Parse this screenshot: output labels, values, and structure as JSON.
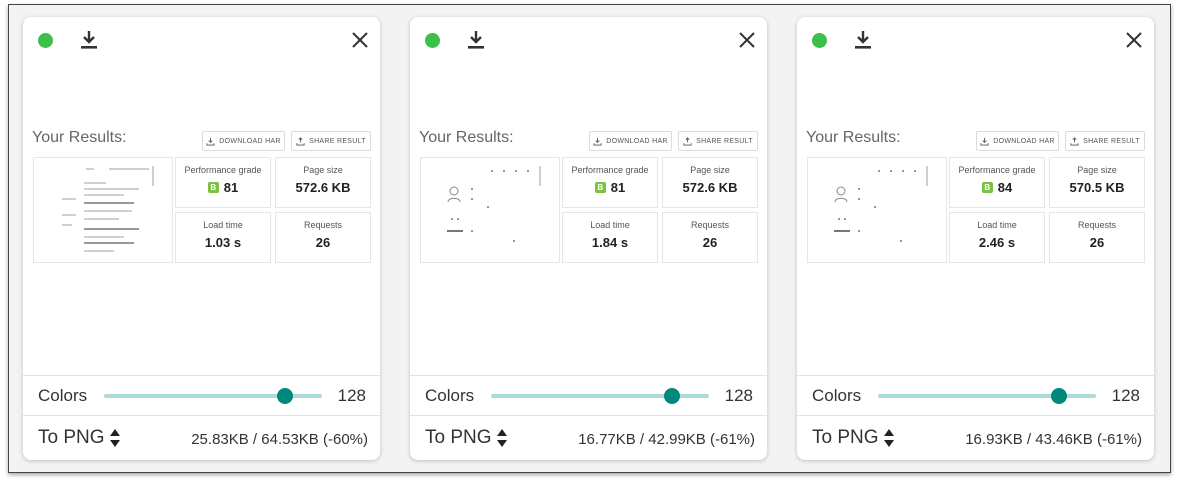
{
  "results_title": "Your Results:",
  "download_har_label": "DOWNLOAD HAR",
  "share_result_label": "SHARE RESULT",
  "labels": {
    "performance": "Performance grade",
    "page_size": "Page size",
    "load_time": "Load time",
    "requests": "Requests"
  },
  "icons": [
    "status-dot",
    "download-icon",
    "close-icon",
    "download-har-icon",
    "share-icon",
    "updown-arrows-icon"
  ],
  "colors_accent": "#00897b",
  "colors_track": "#aadcd9",
  "status_color": "#3cc04a",
  "grade_color": "#7bc143",
  "cards": [
    {
      "grade_letter": "B",
      "grade_value": "81",
      "page_size": "572.6 KB",
      "load_time": "1.03 s",
      "requests": "26",
      "colors_label": "Colors",
      "colors_value": "128",
      "format": "To PNG",
      "size_text": "25.83KB / 64.53KB (-60%)",
      "slider_fraction": 0.83
    },
    {
      "grade_letter": "B",
      "grade_value": "81",
      "page_size": "572.6 KB",
      "load_time": "1.84 s",
      "requests": "26",
      "colors_label": "Colors",
      "colors_value": "128",
      "format": "To PNG",
      "size_text": "16.77KB / 42.99KB (-61%)",
      "slider_fraction": 0.83
    },
    {
      "grade_letter": "B",
      "grade_value": "84",
      "page_size": "570.5 KB",
      "load_time": "2.46 s",
      "requests": "26",
      "colors_label": "Colors",
      "colors_value": "128",
      "format": "To PNG",
      "size_text": "16.93KB / 43.46KB (-61%)",
      "slider_fraction": 0.83
    }
  ]
}
